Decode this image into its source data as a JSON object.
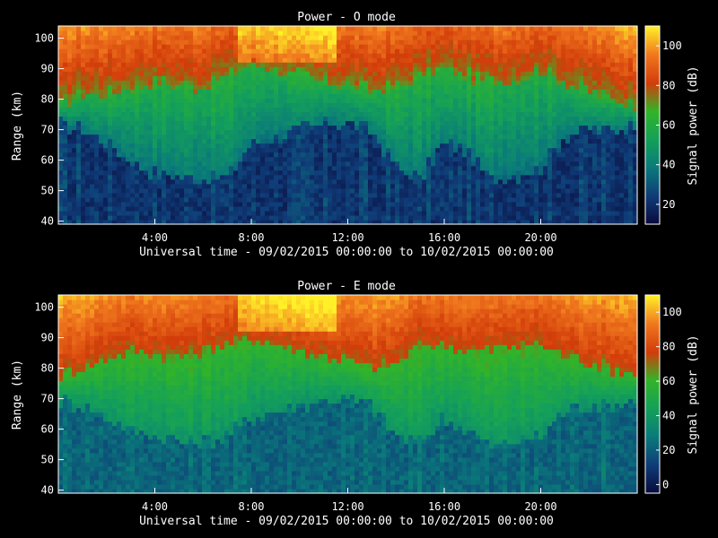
{
  "chart_data": [
    {
      "type": "heatmap",
      "title": "Power - O mode",
      "xlabel": "Universal time - 09/02/2015 00:00:00 to 10/02/2015 00:00:00",
      "ylabel": "Range (km)",
      "colorbar_label": "Signal power (dB)",
      "x_unit": "hours UT",
      "xlim": [
        0,
        24
      ],
      "ylim": [
        39,
        104
      ],
      "x_ticks": [
        {
          "v": 4,
          "label": "4:00"
        },
        {
          "v": 8,
          "label": "8:00"
        },
        {
          "v": 12,
          "label": "12:00"
        },
        {
          "v": 16,
          "label": "16:00"
        },
        {
          "v": 20,
          "label": "20:00"
        }
      ],
      "y_ticks": [
        {
          "v": 40,
          "label": "40"
        },
        {
          "v": 50,
          "label": "50"
        },
        {
          "v": 60,
          "label": "60"
        },
        {
          "v": 70,
          "label": "70"
        },
        {
          "v": 80,
          "label": "80"
        },
        {
          "v": 90,
          "label": "90"
        },
        {
          "v": 100,
          "label": "100"
        }
      ],
      "clim": [
        10,
        110
      ],
      "cbar_ticks": [
        {
          "v": 20,
          "label": "20"
        },
        {
          "v": 40,
          "label": "40"
        },
        {
          "v": 60,
          "label": "60"
        },
        {
          "v": 80,
          "label": "80"
        },
        {
          "v": 100,
          "label": "100"
        }
      ],
      "colormap": [
        "#0a0a3c",
        "#0f3c78",
        "#0a7a7a",
        "#14a05a",
        "#32b428",
        "#d23c0a",
        "#f0781e",
        "#fff028"
      ],
      "profile": {
        "time_h": [
          0,
          1,
          2,
          3,
          4,
          5,
          6,
          7,
          8,
          9,
          10,
          11,
          12,
          13,
          14,
          15,
          16,
          17,
          18,
          19,
          20,
          21,
          22,
          23,
          24
        ],
        "red_bottom_km": [
          78,
          82,
          82,
          84,
          86,
          85,
          84,
          88,
          92,
          90,
          88,
          86,
          85,
          83,
          84,
          88,
          90,
          88,
          86,
          87,
          90,
          86,
          83,
          80,
          78
        ],
        "dark_top_km": [
          72,
          70,
          66,
          60,
          56,
          55,
          54,
          55,
          65,
          68,
          70,
          72,
          72,
          70,
          58,
          54,
          66,
          62,
          54,
          55,
          58,
          68,
          70,
          70,
          72
        ]
      }
    },
    {
      "type": "heatmap",
      "title": "Power - E mode",
      "xlabel": "Universal time - 09/02/2015 00:00:00 to 10/02/2015 00:00:00",
      "ylabel": "Range (km)",
      "colorbar_label": "Signal power (dB)",
      "x_unit": "hours UT",
      "xlim": [
        0,
        24
      ],
      "ylim": [
        39,
        104
      ],
      "x_ticks": [
        {
          "v": 4,
          "label": "4:00"
        },
        {
          "v": 8,
          "label": "8:00"
        },
        {
          "v": 12,
          "label": "12:00"
        },
        {
          "v": 16,
          "label": "16:00"
        },
        {
          "v": 20,
          "label": "20:00"
        }
      ],
      "y_ticks": [
        {
          "v": 40,
          "label": "40"
        },
        {
          "v": 50,
          "label": "50"
        },
        {
          "v": 60,
          "label": "60"
        },
        {
          "v": 70,
          "label": "70"
        },
        {
          "v": 80,
          "label": "80"
        },
        {
          "v": 90,
          "label": "90"
        },
        {
          "v": 100,
          "label": "100"
        }
      ],
      "clim": [
        -5,
        110
      ],
      "cbar_ticks": [
        {
          "v": 0,
          "label": "0"
        },
        {
          "v": 20,
          "label": "20"
        },
        {
          "v": 40,
          "label": "40"
        },
        {
          "v": 60,
          "label": "60"
        },
        {
          "v": 80,
          "label": "80"
        },
        {
          "v": 100,
          "label": "100"
        }
      ],
      "colormap": [
        "#0a0a3c",
        "#0f3c78",
        "#0a7a7a",
        "#14a05a",
        "#32b428",
        "#d23c0a",
        "#f0781e",
        "#fff028"
      ],
      "profile": {
        "time_h": [
          0,
          1,
          2,
          3,
          4,
          5,
          6,
          7,
          8,
          9,
          10,
          11,
          12,
          13,
          14,
          15,
          16,
          17,
          18,
          19,
          20,
          21,
          22,
          23,
          24
        ],
        "red_bottom_km": [
          78,
          80,
          84,
          86,
          85,
          84,
          86,
          88,
          90,
          88,
          86,
          84,
          83,
          80,
          82,
          88,
          88,
          86,
          86,
          88,
          88,
          84,
          82,
          80,
          78
        ],
        "dark_top_km": [
          70,
          68,
          64,
          60,
          58,
          56,
          56,
          58,
          64,
          66,
          68,
          70,
          70,
          68,
          58,
          56,
          64,
          60,
          54,
          56,
          58,
          66,
          68,
          68,
          70
        ]
      }
    }
  ]
}
